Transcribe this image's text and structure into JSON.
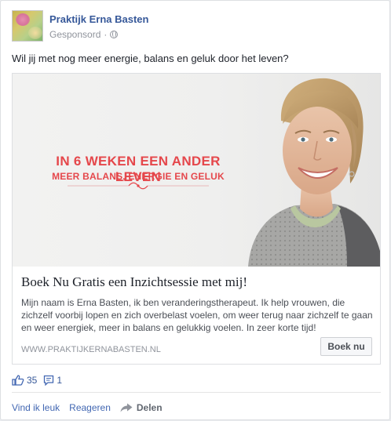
{
  "post": {
    "page_name": "Praktijk Erna Basten",
    "sponsored_label": "Gesponsord",
    "separator": "·",
    "text": "Wil jij met nog meer energie, balans en geluk door het leven?"
  },
  "avatar": {
    "logo_text": "Praktijk Erna Basten"
  },
  "ad": {
    "image_headline": "IN 6 WEKEN EEN ANDER LEVEN",
    "image_subheadline": "MEER BALANS, ENERGIE EN GELUK",
    "title": "Boek Nu Gratis een Inzichtsessie met mij!",
    "description": "Mijn naam is Erna Basten, ik ben veranderingstherapeut. Ik help vrouwen, die zichzelf voorbij lopen en zich overbelast voelen, om weer terug naar zichzelf te gaan en weer energiek, meer in balans en gelukkig voelen. In zeer korte tijd!",
    "url": "WWW.PRAKTIJKERNABASTEN.NL",
    "cta_label": "Boek nu",
    "accent_color": "#e5474b"
  },
  "stats": {
    "likes": "35",
    "comments": "1"
  },
  "actions": {
    "like_label": "Vind ik leuk",
    "comment_label": "Reageren",
    "share_label": "Delen"
  },
  "colors": {
    "link_blue": "#365899",
    "meta_gray": "#90949c"
  }
}
